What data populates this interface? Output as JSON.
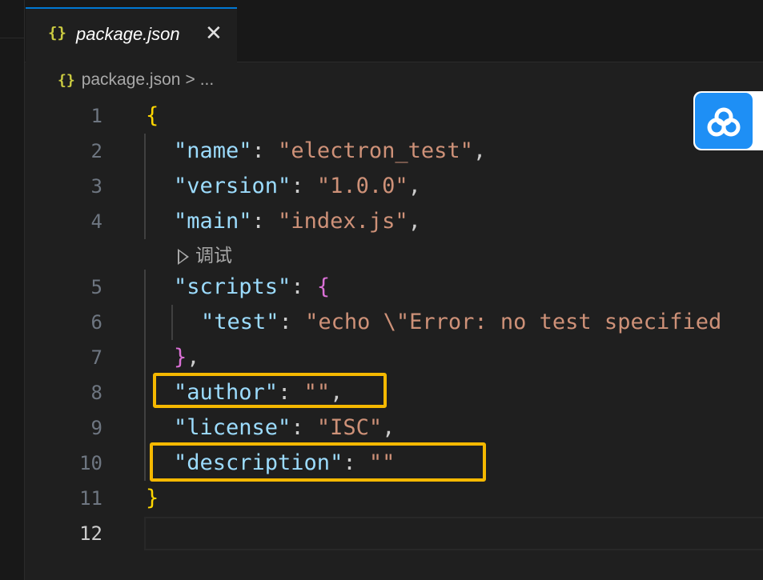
{
  "tab": {
    "icon": "json-braces-icon",
    "icon_text": "{}",
    "label": "package.json",
    "close": "✕"
  },
  "breadcrumb": {
    "icon_text": "{}",
    "file": "package.json",
    "sep": ">",
    "more": "..."
  },
  "codelens": {
    "label": "调试"
  },
  "line_numbers": [
    "1",
    "2",
    "3",
    "4",
    "5",
    "6",
    "7",
    "8",
    "9",
    "10",
    "11",
    "12"
  ],
  "active_line": "12",
  "code": {
    "l1_open": "{",
    "l2_key": "\"name\"",
    "l2_colon": ": ",
    "l2_val": "\"electron_test\"",
    "l2_comma": ",",
    "l3_key": "\"version\"",
    "l3_colon": ": ",
    "l3_val": "\"1.0.0\"",
    "l3_comma": ",",
    "l4_key": "\"main\"",
    "l4_colon": ": ",
    "l4_val": "\"index.js\"",
    "l4_comma": ",",
    "l5_key": "\"scripts\"",
    "l5_colon": ": ",
    "l5_open": "{",
    "l6_key": "\"test\"",
    "l6_colon": ": ",
    "l6_val": "\"echo \\\"Error: no test specified",
    "l7_close": "}",
    "l7_comma": ",",
    "l8_key": "\"author\"",
    "l8_colon": ": ",
    "l8_val": "\"\"",
    "l8_comma": ",",
    "l9_key": "\"license\"",
    "l9_colon": ": ",
    "l9_val": "\"ISC\"",
    "l9_comma": ",",
    "l10_key": "\"description\"",
    "l10_colon": ": ",
    "l10_val": "\"\"",
    "l11_close": "}"
  },
  "colors": {
    "accent": "#0078d4",
    "highlight": "#f5b800",
    "floating_button": "#1e8ff5"
  },
  "floating_button": {
    "icon": "cloud-sync-icon"
  }
}
